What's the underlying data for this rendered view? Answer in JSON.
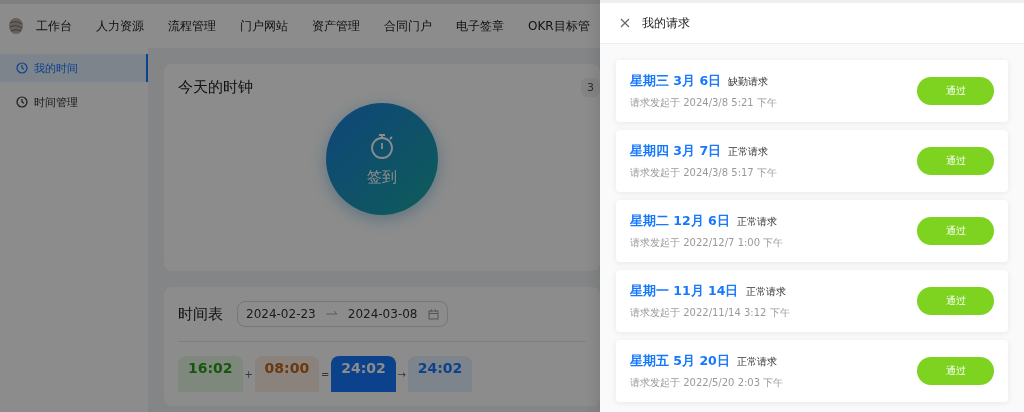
{
  "nav": {
    "items": [
      {
        "label": "工作台",
        "selected": false
      },
      {
        "label": "人力资源",
        "selected": false
      },
      {
        "label": "流程管理",
        "selected": false
      },
      {
        "label": "门户网站",
        "selected": false
      },
      {
        "label": "资产管理",
        "selected": false
      },
      {
        "label": "合同门户",
        "selected": false
      },
      {
        "label": "电子签章",
        "selected": false
      },
      {
        "label": "OKR目标管",
        "selected": false
      }
    ]
  },
  "sidebar": {
    "items": [
      {
        "label": "我的时间",
        "selected": true
      },
      {
        "label": "时间管理",
        "selected": false
      }
    ]
  },
  "clock_card": {
    "title": "今天的时钟",
    "badge": "3",
    "button": "签到"
  },
  "timesheet": {
    "title": "时间表",
    "date_start": "2024-02-23",
    "date_end": "2024-03-08",
    "tiles": [
      {
        "value": "16:02",
        "kind": "green",
        "op": "+"
      },
      {
        "value": "08:00",
        "kind": "orange",
        "op": "="
      },
      {
        "value": "24:02",
        "kind": "blue",
        "op": "→"
      },
      {
        "value": "24:02",
        "kind": "light"
      }
    ]
  },
  "drawer": {
    "title": "我的请求",
    "requests": [
      {
        "date": "星期三 3月 6日",
        "type": "缺勤请求",
        "submitted": "请求发起于 2024/3/8 5:21 下午",
        "action": "通过"
      },
      {
        "date": "星期四 3月 7日",
        "type": "正常请求",
        "submitted": "请求发起于 2024/3/8 5:17 下午",
        "action": "通过"
      },
      {
        "date": "星期二 12月 6日",
        "type": "正常请求",
        "submitted": "请求发起于 2022/12/7 1:00 下午",
        "action": "通过"
      },
      {
        "date": "星期一 11月 14日",
        "type": "正常请求",
        "submitted": "请求发起于 2022/11/14 3:12 下午",
        "action": "通过"
      },
      {
        "date": "星期五 5月 20日",
        "type": "正常请求",
        "submitted": "请求发起于 2022/5/20 2:03 下午",
        "action": "通过"
      }
    ]
  }
}
